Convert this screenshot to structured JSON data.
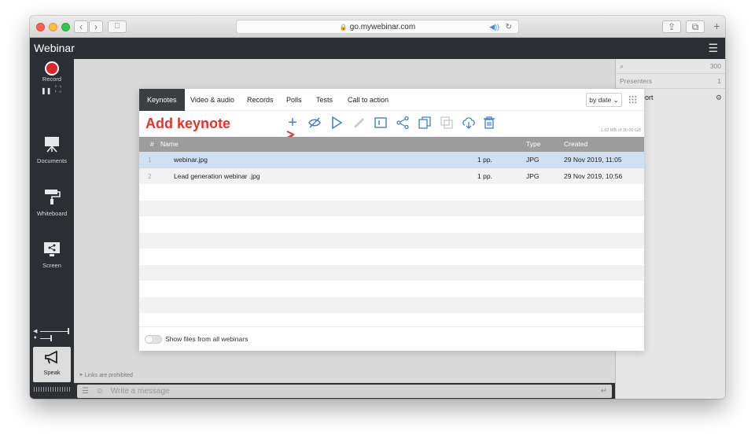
{
  "browser": {
    "url": "go.mywebinar.com",
    "back_glyph": "‹",
    "forward_glyph": "›",
    "sidebar_glyph": "⎕",
    "share_glyph": "⇪",
    "tabs_glyph": "⧉",
    "newtab_glyph": "+"
  },
  "app": {
    "title": "Webinar",
    "menu_glyph": "☰"
  },
  "sidebar": {
    "record_label": "Record",
    "pause_glyph": "❚❚",
    "fullscreen_glyph": "⛶",
    "documents_label": "Documents",
    "whiteboard_label": "Whiteboard",
    "screen_label": "Screen",
    "speak_label": "Speak",
    "volume_glyph": "🔈"
  },
  "right_panel": {
    "search_glyph": "🔍",
    "count": "300",
    "presenters_label": "Presenters",
    "presenters_count": "1",
    "support_fragment": "ort",
    "gear_glyph": "⚙"
  },
  "message": {
    "placeholder": "Write a message",
    "links_note": "Links are prohibited"
  },
  "modal": {
    "tabs": [
      {
        "label": "Keynotes",
        "active": true
      },
      {
        "label": "Video & audio"
      },
      {
        "label": "Records"
      },
      {
        "label": "Polls"
      },
      {
        "label": "Tests"
      },
      {
        "label": "Call to action"
      }
    ],
    "sort_label": "by date",
    "sort_arrow": "⌄",
    "add_label": "Add keynote",
    "tools": {
      "add": "+",
      "hide": "⊘",
      "play": "▷",
      "edit": "✎",
      "rename": "⊡",
      "share": "⋖",
      "copy": "⧉",
      "move": "⧉",
      "download": "⇩",
      "delete": "🗑"
    },
    "storage": "1.92 MB of 30.00 GB",
    "columns": {
      "num": "#",
      "name": "Name",
      "type": "Type",
      "created": "Created"
    },
    "rows": [
      {
        "num": "1",
        "name": "webinar.jpg",
        "pages": "1 pp.",
        "type": "JPG",
        "created": "29 Nov 2019, 11:05",
        "selected": true
      },
      {
        "num": "2",
        "name": "Lead generation webinar .jpg",
        "pages": "1 pp.",
        "type": "JPG",
        "created": "29 Nov 2019, 10:56",
        "selected": false
      }
    ],
    "footer_label": "Show files from all webinars"
  },
  "colors": {
    "accent_blue": "#3d7fd8",
    "record_red": "#e0262c",
    "annotation_red": "#e8322a",
    "selected_row": "#cfe0f2",
    "stripe": "#f2f2f2"
  }
}
